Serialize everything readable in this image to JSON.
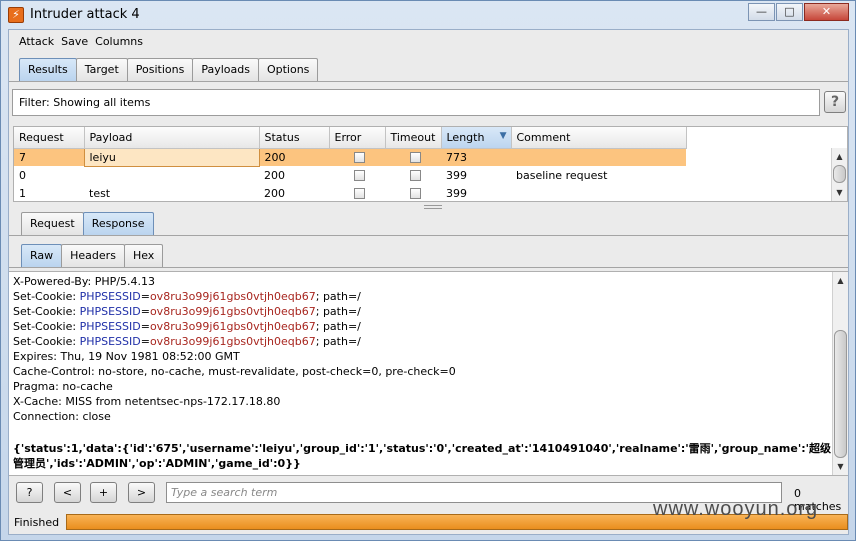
{
  "window": {
    "title": "Intruder attack 4",
    "app_icon_glyph": "⚡"
  },
  "window_controls": {
    "minimize": "—",
    "maximize": "□",
    "close": "✕"
  },
  "menu": [
    "Attack",
    "Save",
    "Columns"
  ],
  "main_tabs": [
    "Results",
    "Target",
    "Positions",
    "Payloads",
    "Options"
  ],
  "filter": {
    "text": "Filter:  Showing all items",
    "help": "?"
  },
  "results": {
    "columns": [
      "Request",
      "Payload",
      "Status",
      "Error",
      "Timeout",
      "Length",
      "Comment"
    ],
    "sort_arrow": "▼",
    "rows": [
      {
        "request": "7",
        "payload": "leiyu",
        "status": "200",
        "length": "773",
        "comment": ""
      },
      {
        "request": "0",
        "payload": "",
        "status": "200",
        "length": "399",
        "comment": "baseline request"
      },
      {
        "request": "1",
        "payload": "test",
        "status": "200",
        "length": "399",
        "comment": ""
      }
    ]
  },
  "sub_tabs": [
    "Request",
    "Response"
  ],
  "view_tabs": [
    "Raw",
    "Headers",
    "Hex"
  ],
  "response": {
    "powered_by": "X-Powered-By: PHP/5.4.13",
    "set_cookie_prefix": "Set-Cookie: ",
    "cookie_name": "PHPSESSID",
    "cookie_eq": "=",
    "cookie_value": "ov8ru3o99j61gbs0vtjh0eqb67",
    "cookie_suffix": "; path=/",
    "expires": "Expires: Thu, 19 Nov 1981 08:52:00 GMT",
    "cache_control": "Cache-Control: no-store, no-cache, must-revalidate, post-check=0, pre-check=0",
    "pragma": "Pragma: no-cache",
    "x_cache": "X-Cache: MISS from netentsec-nps-172.17.18.80",
    "connection": "Connection: close",
    "body_line1": "{'status':1,'data':{'id':'675','username':'leiyu','group_id':'1','status':'0','created_at':'1410491040','realname':'雷雨','group_name':'超级",
    "body_line2": "管理员','ids':'ADMIN','op':'ADMIN','game_id':0}}"
  },
  "search": {
    "help": "?",
    "prev": "<",
    "add": "+",
    "next": ">",
    "placeholder": "Type a search term",
    "matches": "0 matches"
  },
  "status": {
    "text": "Finished",
    "progress": 1.0
  },
  "watermark": "www.wooyun.org"
}
